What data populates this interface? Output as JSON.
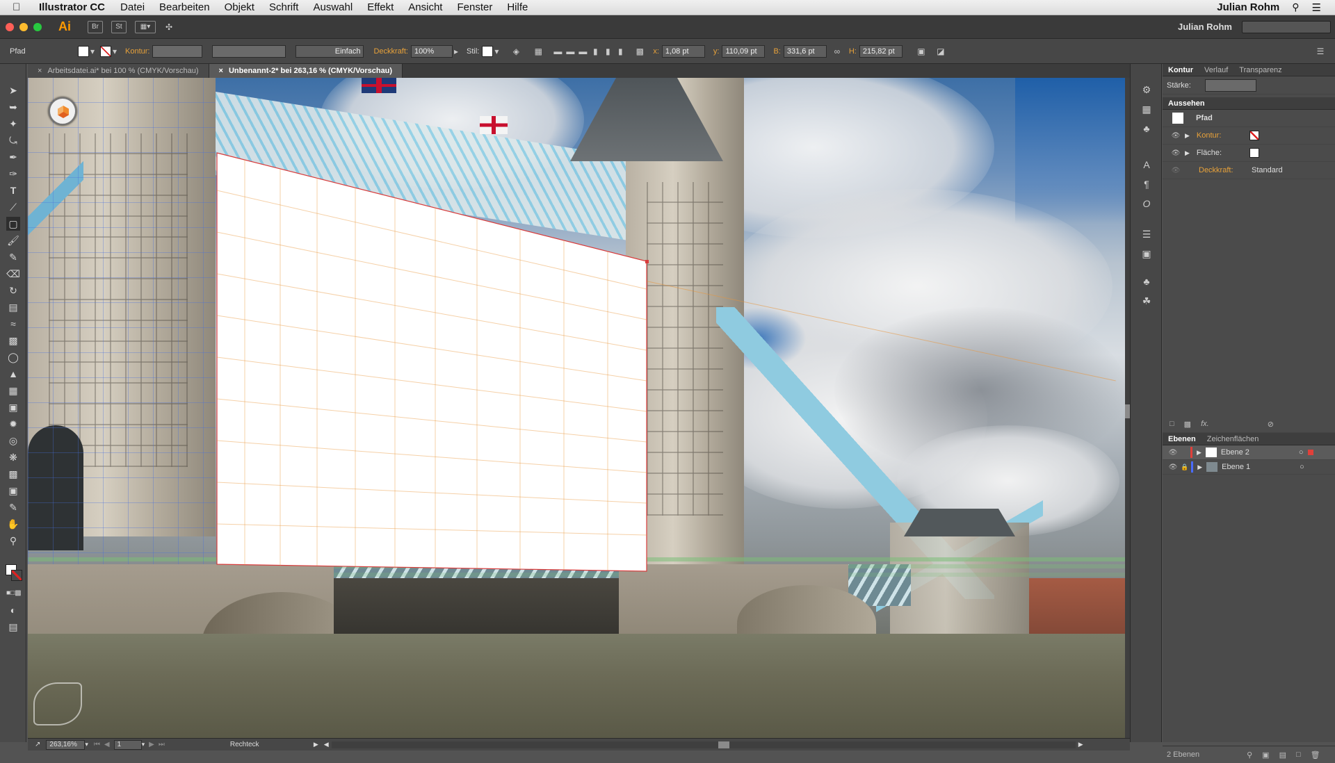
{
  "menubar": {
    "app_name": "Illustrator CC",
    "menus": [
      "Datei",
      "Bearbeiten",
      "Objekt",
      "Schrift",
      "Auswahl",
      "Effekt",
      "Ansicht",
      "Fenster",
      "Hilfe"
    ],
    "user": "Julian Rohm"
  },
  "appbar": {
    "app_badge": "Ai",
    "bridge": "Br",
    "stock": "St",
    "user": "Julian Rohm"
  },
  "controlbar": {
    "object_type": "Pfad",
    "stroke_label": "Kontur:",
    "stroke_style": "Einfach",
    "opacity_label": "Deckkraft:",
    "opacity_value": "100%",
    "style_label": "Stil:",
    "x_label": "x:",
    "x_value": "1,08 pt",
    "y_label": "y:",
    "y_value": "110,09 pt",
    "w_label": "B:",
    "w_value": "331,6 pt",
    "h_label": "H:",
    "h_value": "215,82 pt"
  },
  "tabs": [
    {
      "label": "Arbeitsdatei.ai* bei 100 % (CMYK/Vorschau)",
      "active": false
    },
    {
      "label": "Unbenannt-2* bei 263,16 % (CMYK/Vorschau)",
      "active": true
    }
  ],
  "panels": {
    "stroke_tabs": [
      "Kontur",
      "Verlauf",
      "Transparenz"
    ],
    "stroke_weight_label": "Stärke:",
    "appearance_title": "Aussehen",
    "appearance_object": "Pfad",
    "appearance_rows": [
      {
        "label": "Kontur:",
        "value": ""
      },
      {
        "label": "Fläche:",
        "value": ""
      },
      {
        "label": "Deckkraft:",
        "value": "Standard"
      }
    ],
    "layers_tabs": [
      "Ebenen",
      "Zeichenflächen"
    ],
    "layers": [
      {
        "name": "Ebene 2",
        "color": "#e0403a",
        "selected": true
      },
      {
        "name": "Ebene 1",
        "color": "#4a6bff",
        "selected": false
      }
    ],
    "layers_count": "2 Ebenen"
  },
  "statusbar": {
    "zoom": "263,16%",
    "artboard": "1",
    "tool": "Rechteck"
  },
  "colors": {
    "accent_orange": "#e8a23a",
    "selection_red": "#e0403a"
  }
}
